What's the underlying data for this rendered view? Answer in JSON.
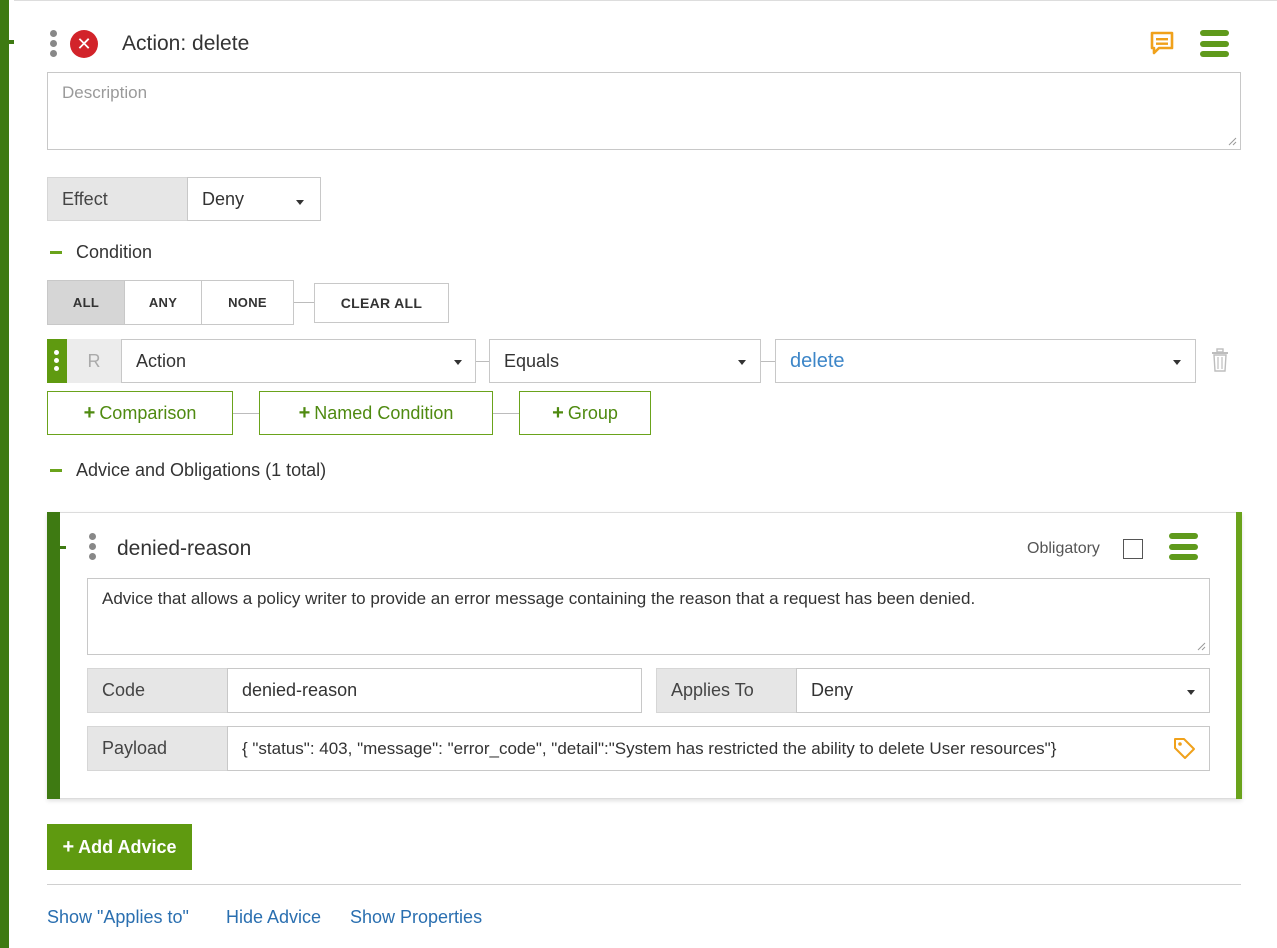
{
  "rule": {
    "title": "Action: delete",
    "description_placeholder": "Description",
    "effect_label": "Effect",
    "effect_value": "Deny"
  },
  "condition": {
    "header": "Condition",
    "buttons": [
      "ALL",
      "ANY",
      "NONE"
    ],
    "active_button": "ALL",
    "clear_all": "CLEAR ALL",
    "row": {
      "badge": "R",
      "attribute": "Action",
      "operator": "Equals",
      "value": "delete"
    },
    "add_buttons": [
      "Comparison",
      "Named Condition",
      "Group"
    ]
  },
  "advice": {
    "header": "Advice and Obligations (1 total)",
    "card": {
      "name": "denied-reason",
      "obligatory_label": "Obligatory",
      "obligatory_checked": false,
      "description": "Advice that allows a policy writer to provide an error message containing the reason that a request has been denied.",
      "code_label": "Code",
      "code_value": "denied-reason",
      "applies_to_label": "Applies To",
      "applies_to_value": "Deny",
      "payload_label": "Payload",
      "payload_value": "{ \"status\": 403, \"message\": \"error_code\", \"detail\":\"System has restricted the ability to delete User resources\"}"
    },
    "add_button": "Add Advice"
  },
  "footer_links": [
    "Show \"Applies to\"",
    "Hide Advice",
    "Show Properties"
  ],
  "icons": {
    "remove": "x-circle-icon",
    "comment": "comment-icon",
    "menu": "hamburger-menu-icon",
    "trash": "trash-icon",
    "tag": "tag-icon"
  },
  "colors": {
    "accent_green": "#6aa31b",
    "dark_green": "#3e7a12",
    "danger_red": "#d2232a",
    "comment_orange": "#f0a11b",
    "link_blue": "#2a6fb0"
  }
}
